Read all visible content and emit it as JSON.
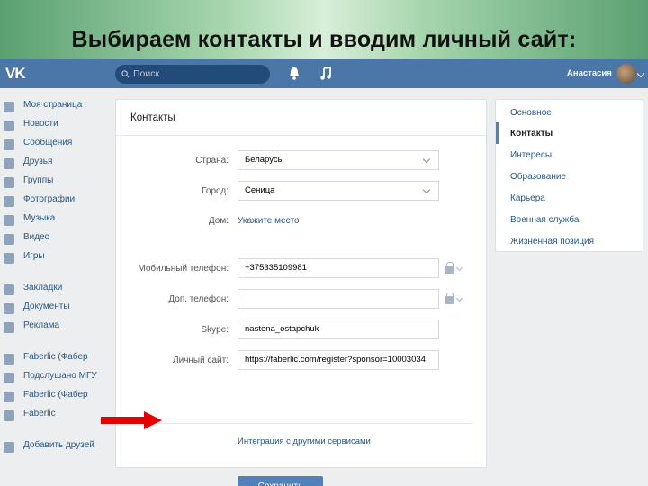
{
  "slide": {
    "title": "Выбираем контакты и вводим личный сайт:"
  },
  "topbar": {
    "logo": "VK",
    "search_placeholder": "Поиск",
    "username": "Анастасия",
    "icons": [
      "search-icon",
      "bell-icon",
      "music-icon"
    ]
  },
  "sidebar": {
    "items": [
      {
        "label": "Моя страница",
        "icon": "home-icon"
      },
      {
        "label": "Новости",
        "icon": "news-icon"
      },
      {
        "label": "Сообщения",
        "icon": "message-icon"
      },
      {
        "label": "Друзья",
        "icon": "user-icon"
      },
      {
        "label": "Группы",
        "icon": "group-icon"
      },
      {
        "label": "Фотографии",
        "icon": "camera-icon"
      },
      {
        "label": "Музыка",
        "icon": "music-icon"
      },
      {
        "label": "Видео",
        "icon": "video-icon"
      },
      {
        "label": "Игры",
        "icon": "gamepad-icon"
      },
      {
        "label": "Закладки",
        "icon": "star-icon"
      },
      {
        "label": "Документы",
        "icon": "document-icon"
      },
      {
        "label": "Реклама",
        "icon": "ads-icon"
      },
      {
        "label": "Faberlic (Фабер",
        "icon": "group-icon"
      },
      {
        "label": "Подслушано МГУ",
        "icon": "group-icon"
      },
      {
        "label": "Faberlic (Фабер",
        "icon": "group-icon"
      },
      {
        "label": "Faberlic",
        "icon": "group-icon"
      },
      {
        "label": "Добавить друзей",
        "icon": "apps-icon"
      }
    ]
  },
  "form": {
    "title": "Контакты",
    "country_label": "Страна:",
    "country_value": "Беларусь",
    "city_label": "Город:",
    "city_value": "Сеница",
    "home_label": "Дом:",
    "home_link": "Укажите место",
    "mobile_label": "Мобильный телефон:",
    "mobile_value": "+375335109981",
    "extra_phone_label": "Доп. телефон:",
    "extra_phone_value": "",
    "skype_label": "Skype:",
    "skype_value": "nastena_ostapchuk",
    "site_label": "Личный сайт:",
    "site_value": "https://faberlic.com/register?sponsor=10003034",
    "integration_link": "Интеграция с другими сервисами",
    "save_label": "Сохранить"
  },
  "rightnav": {
    "items": [
      "Основное",
      "Контакты",
      "Интересы",
      "Образование",
      "Карьера",
      "Военная служба",
      "Жизненная позиция"
    ],
    "active_index": 1
  },
  "colors": {
    "accent": "#4a76a8",
    "button": "#5181b8",
    "link": "#2a5885",
    "pointer_arrow": "#e60000"
  }
}
